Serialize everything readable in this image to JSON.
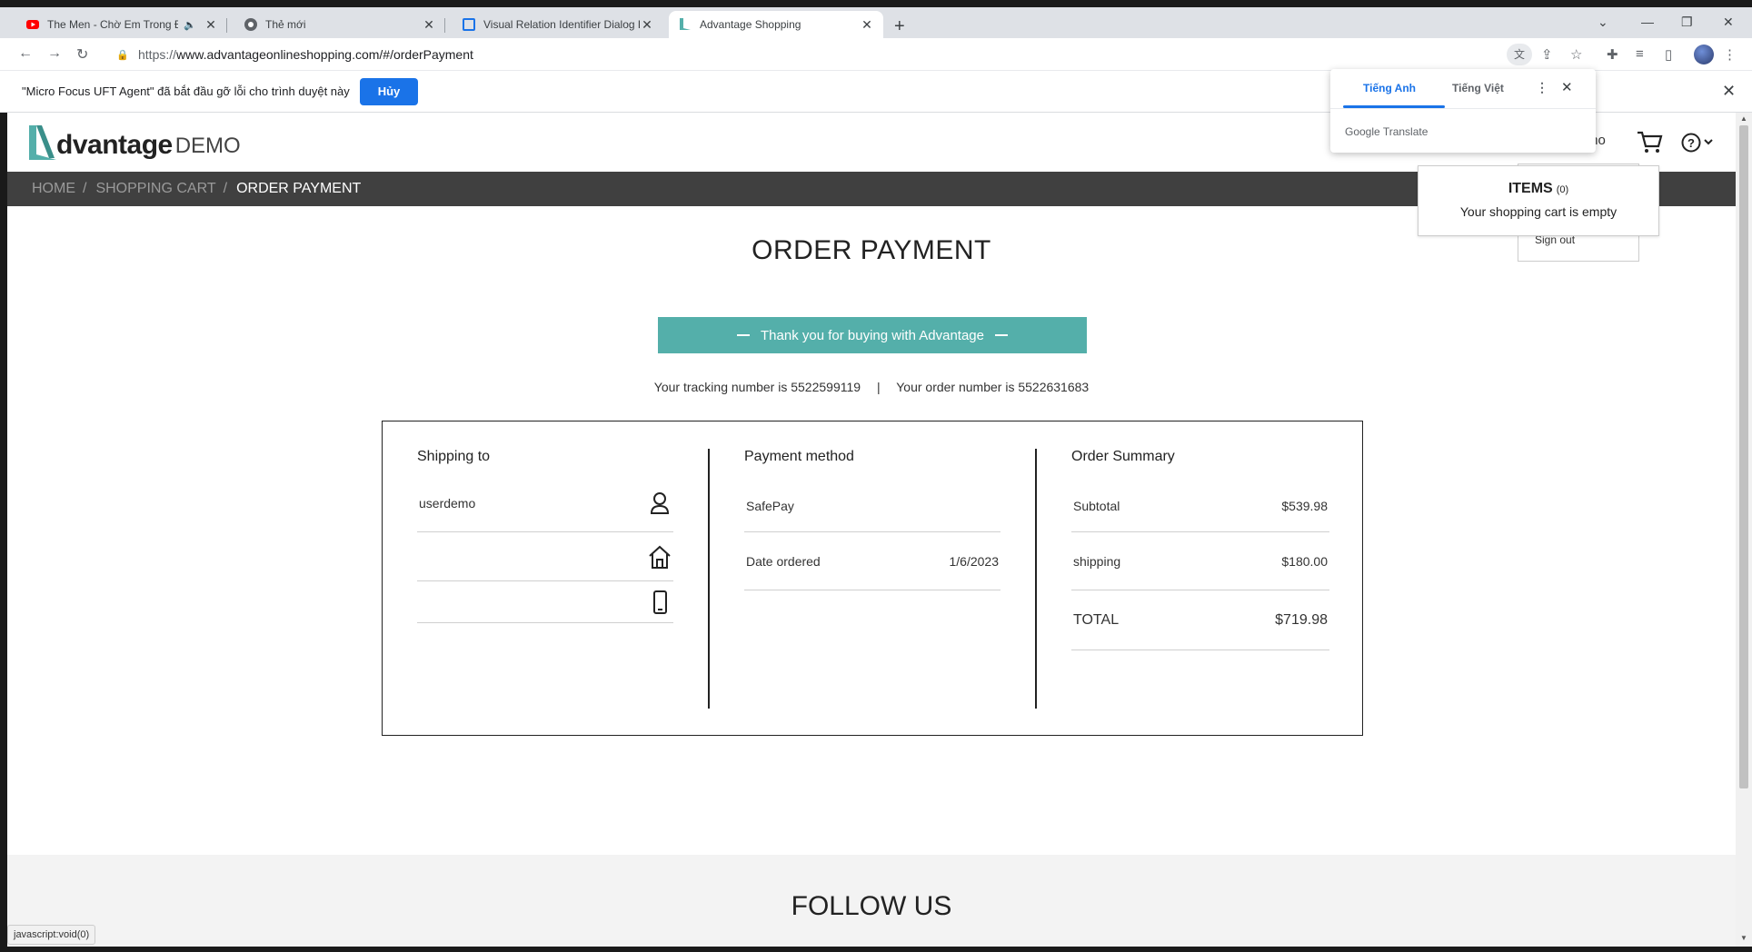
{
  "browser": {
    "tabs": [
      {
        "title": "The Men - Chờ Em Trong Đê",
        "favicon": "youtube-icon",
        "muted": true
      },
      {
        "title": "Thẻ mới",
        "favicon": "chrome-icon"
      },
      {
        "title": "Visual Relation Identifier Dialog E",
        "favicon": "dialog-icon"
      },
      {
        "title": "Advantage Shopping",
        "favicon": "advantage-icon"
      }
    ],
    "url_prefix": "https://",
    "url_rest": "www.advantageonlineshopping.com/#/orderPayment",
    "infobar": {
      "message": "\"Micro Focus UFT Agent\" đã bắt đầu gỡ lỗi cho trình duyệt này",
      "button": "Hủy"
    },
    "translate": {
      "tab_source": "Tiếng Anh",
      "tab_target": "Tiếng Việt",
      "brand_google": "Google",
      "brand_translate": "Translate"
    },
    "status_text": "javascript:void(0)"
  },
  "site": {
    "logo_word": "dvantage",
    "logo_demo": "DEMO",
    "user_partial": "mo",
    "brand_color": "#54afaa"
  },
  "breadcrumb": {
    "home": "HOME",
    "cart": "SHOPPING CART",
    "current": "ORDER PAYMENT"
  },
  "page": {
    "title": "ORDER PAYMENT",
    "thanks": "Thank you for buying with Advantage",
    "tracking_label": "Your tracking number is",
    "tracking_number": "5522599119",
    "separator": "|",
    "order_label": "Your order number is",
    "order_number": "5522631683"
  },
  "shipping": {
    "title": "Shipping to",
    "name": "userdemo"
  },
  "payment": {
    "title": "Payment method",
    "method": "SafePay",
    "date_label": "Date ordered",
    "date_value": "1/6/2023"
  },
  "order_summary": {
    "title": "Order Summary",
    "subtotal_label": "Subtotal",
    "subtotal_value": "$539.98",
    "shipping_label": "shipping",
    "shipping_value": "$180.00",
    "total_label": "TOTAL",
    "total_value": "$719.98"
  },
  "cart_popup": {
    "items_label": "ITEMS",
    "items_count": "(0)",
    "empty_text": "Your shopping cart is empty"
  },
  "user_menu": {
    "sign_out": "Sign out"
  },
  "footer": {
    "follow": "FOLLOW US"
  }
}
